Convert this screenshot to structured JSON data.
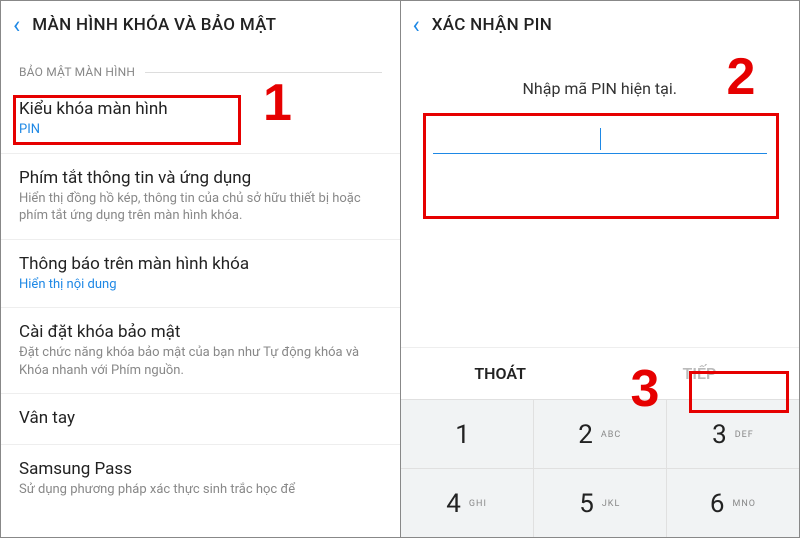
{
  "left": {
    "header_title": "MÀN HÌNH KHÓA VÀ BẢO MẬT",
    "section_label": "BẢO MẬT MÀN HÌNH",
    "items": [
      {
        "title": "Kiểu khóa màn hình",
        "sub": "PIN",
        "accent": true
      },
      {
        "title": "Phím tắt thông tin và ứng dụng",
        "sub": "Hiển thị đồng hồ kép, thông tin của chủ sở hữu thiết bị hoặc phím tắt ứng dụng trên màn hình khóa."
      },
      {
        "title": "Thông báo trên màn hình khóa",
        "sub": "Hiển thị nội dung",
        "accent": true
      },
      {
        "title": "Cài đặt khóa bảo mật",
        "sub": "Đặt chức năng khóa bảo mật của bạn như Tự động khóa và Khóa nhanh với Phím nguồn."
      },
      {
        "title": "Vân tay",
        "sub": ""
      },
      {
        "title": "Samsung Pass",
        "sub": "Sử dụng phương pháp xác thực sinh trắc học để"
      }
    ]
  },
  "right": {
    "header_title": "XÁC NHẬN PIN",
    "prompt": "Nhập mã PIN hiện tại.",
    "cancel": "THOÁT",
    "next": "TIẾP",
    "keys": [
      {
        "num": "1",
        "let": ""
      },
      {
        "num": "2",
        "let": "ABC"
      },
      {
        "num": "3",
        "let": "DEF"
      },
      {
        "num": "4",
        "let": "GHI"
      },
      {
        "num": "5",
        "let": "JKL"
      },
      {
        "num": "6",
        "let": "MNO"
      }
    ]
  },
  "annotations": {
    "one": "1",
    "two": "2",
    "three": "3"
  }
}
